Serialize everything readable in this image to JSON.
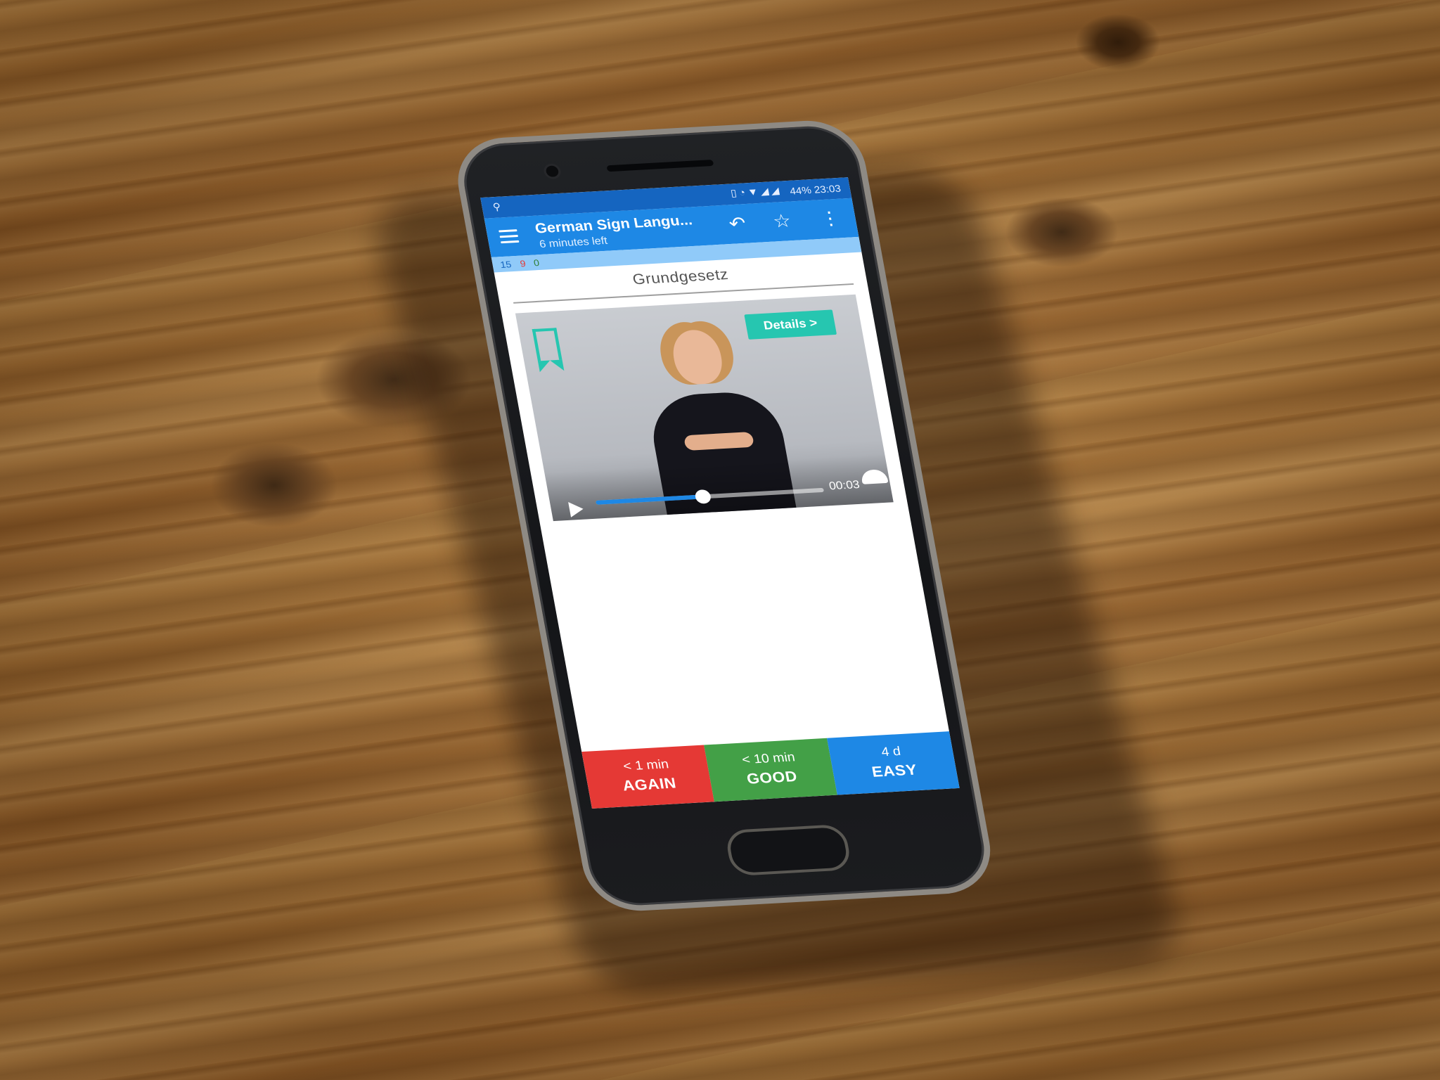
{
  "status_bar": {
    "left_icon": "accessibility-icon",
    "icons": [
      "vibrate-icon",
      "alarm-icon",
      "wifi-icon",
      "signal-icon",
      "signal-icon"
    ],
    "text": "44% 23:03"
  },
  "app_bar": {
    "title": "German Sign Langu...",
    "subtitle": "6 minutes left",
    "icons": [
      "menu-icon",
      "undo-icon",
      "star-icon",
      "more-icon"
    ]
  },
  "counts": {
    "new": "15",
    "learn": "9",
    "review": "0",
    "colors": {
      "new": "#1565c0",
      "learn": "#e53935",
      "review": "#2e7d32"
    }
  },
  "card": {
    "title": "Grundgesetz",
    "details_button": "Details >",
    "bookmark_icon": "bookmark-icon",
    "bookmark_color": "#26c6b0"
  },
  "video_player": {
    "time": "00:03",
    "progress": 0.47,
    "icons": [
      "play-icon",
      "speedometer-icon",
      "fullscreen-icon"
    ],
    "accent_color": "#1e88e5"
  },
  "answer_buttons": [
    {
      "interval": "< 1 min",
      "label": "AGAIN",
      "color": "#e53935"
    },
    {
      "interval": "< 10 min",
      "label": "GOOD",
      "color": "#43a047"
    },
    {
      "interval": "4 d",
      "label": "EASY",
      "color": "#1e88e5"
    }
  ]
}
